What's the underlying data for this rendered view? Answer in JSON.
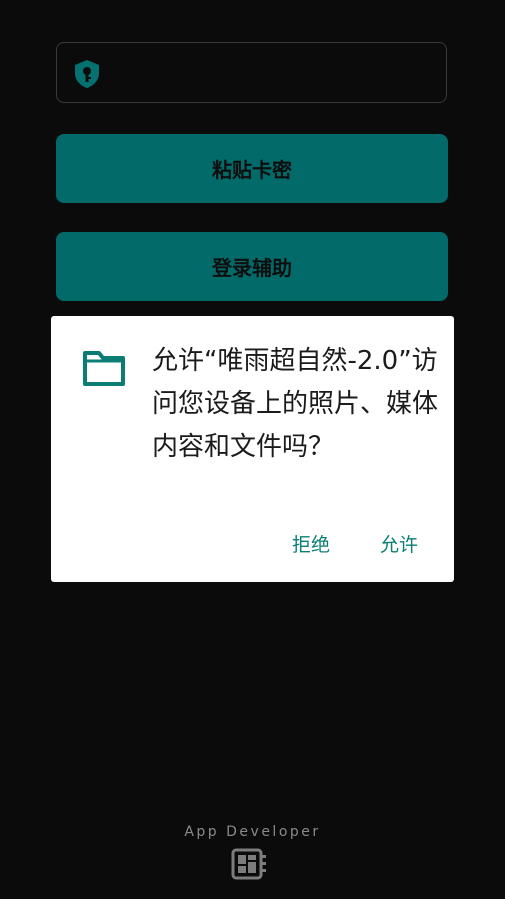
{
  "login": {
    "key_input": {
      "value": "",
      "placeholder": ""
    },
    "paste_button": "粘贴卡密",
    "login_button": "登录辅助"
  },
  "dialog": {
    "message": "允许“唯雨超自然-2.0”访问您设备上的照片、媒体内容和文件吗？",
    "deny_label": "拒绝",
    "allow_label": "允许"
  },
  "footer": {
    "developer_label": "App Developer"
  },
  "icons": {
    "key_field": "shield-key-icon",
    "dialog": "folder-icon",
    "footer": "developer-board-icon"
  },
  "colors": {
    "accent": "#036a6a",
    "dialog_action": "#0b7d74",
    "background": "#0b0b0c"
  }
}
